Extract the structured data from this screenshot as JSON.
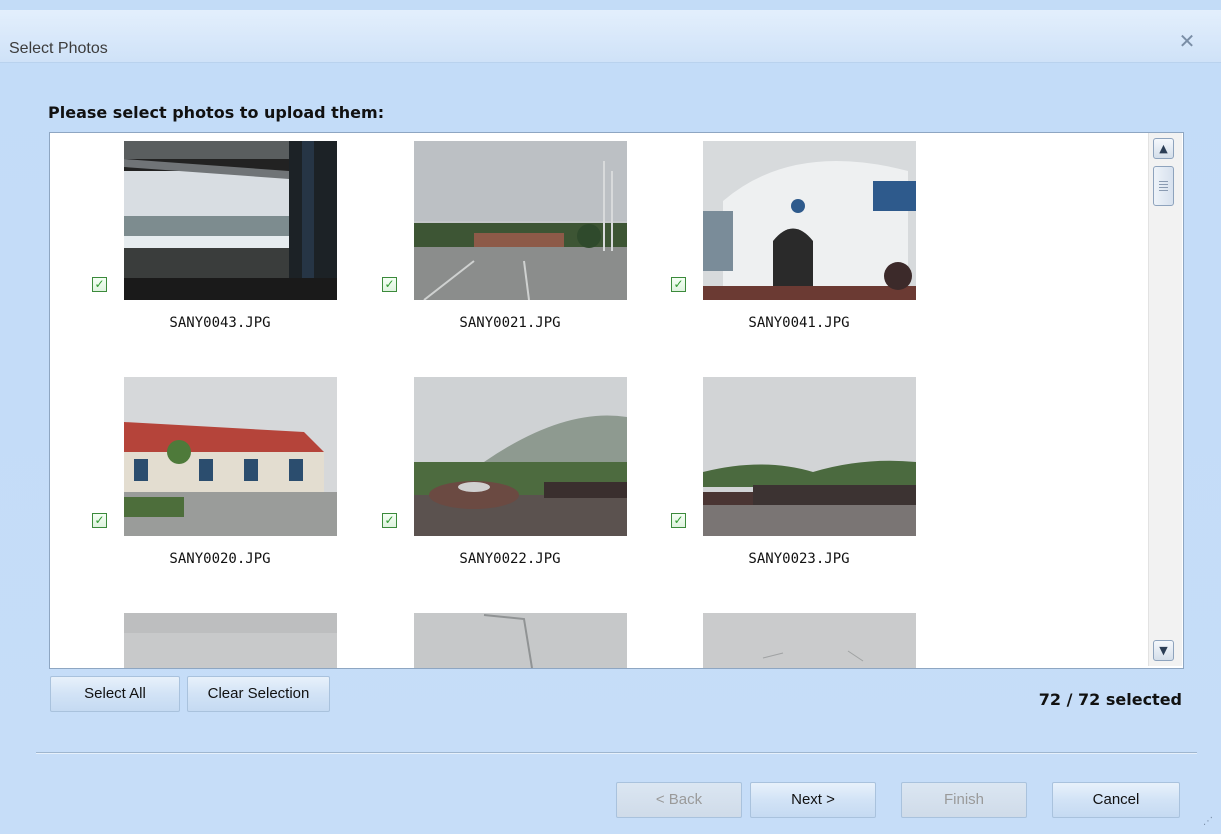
{
  "window": {
    "title": "Select Photos",
    "close_icon": "close-icon"
  },
  "instruction": "Please select photos to upload them:",
  "photos": [
    {
      "filename": "SANY0043.JPG",
      "checked": true
    },
    {
      "filename": "SANY0021.JPG",
      "checked": true
    },
    {
      "filename": "SANY0041.JPG",
      "checked": true
    },
    {
      "filename": "SANY0020.JPG",
      "checked": true
    },
    {
      "filename": "SANY0022.JPG",
      "checked": true
    },
    {
      "filename": "SANY0023.JPG",
      "checked": true
    }
  ],
  "buttons": {
    "select_all": "Select All",
    "clear_selection": "Clear Selection",
    "back": "< Back",
    "next": "Next >",
    "finish": "Finish",
    "cancel": "Cancel"
  },
  "selection_count": "72 / 72 selected",
  "colors": {
    "background": "#c3dcf7",
    "check_green": "#2f9a2f"
  }
}
